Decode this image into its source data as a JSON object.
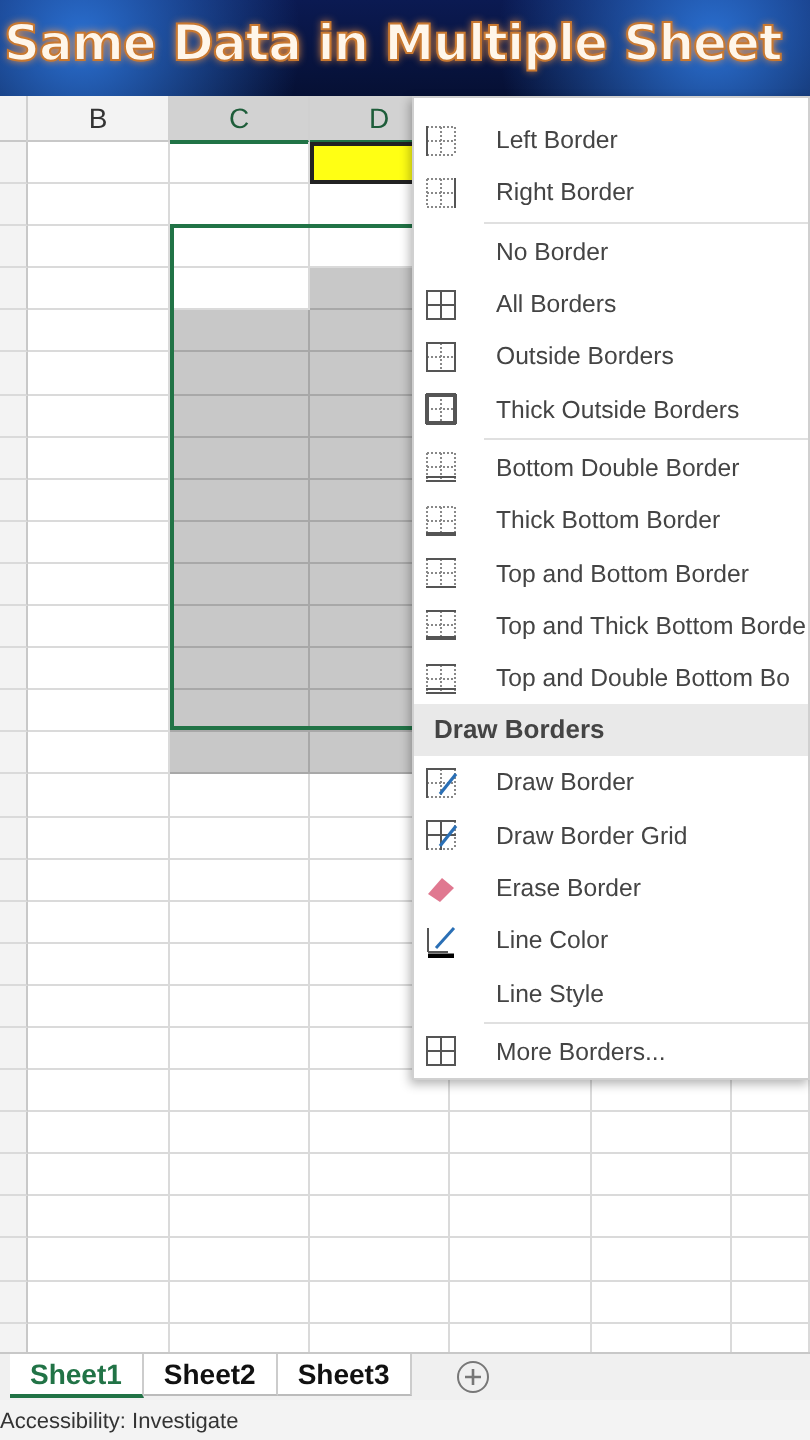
{
  "banner": {
    "title": "Same Data in Multiple Sheet"
  },
  "columns": [
    {
      "label": "B",
      "selected": false
    },
    {
      "label": "C",
      "selected": true
    },
    {
      "label": "D",
      "selected": true
    }
  ],
  "menu": {
    "items": [
      {
        "kind": "item",
        "label": "Left Border"
      },
      {
        "kind": "item",
        "label": "Right Border"
      },
      {
        "kind": "separator"
      },
      {
        "kind": "item",
        "label": "No Border"
      },
      {
        "kind": "item",
        "label": "All Borders"
      },
      {
        "kind": "item",
        "label": "Outside Borders"
      },
      {
        "kind": "item",
        "label": "Thick Outside Borders"
      },
      {
        "kind": "separator"
      },
      {
        "kind": "item",
        "label": "Bottom Double Border"
      },
      {
        "kind": "item",
        "label": "Thick Bottom Border"
      },
      {
        "kind": "item",
        "label": "Top and Bottom Border"
      },
      {
        "kind": "item",
        "label": "Top and Thick Bottom Borde"
      },
      {
        "kind": "item",
        "label": "Top and Double Bottom Bo"
      },
      {
        "kind": "header",
        "label": "Draw Borders"
      },
      {
        "kind": "item",
        "label": "Draw Border"
      },
      {
        "kind": "item",
        "label": "Draw Border Grid"
      },
      {
        "kind": "item",
        "label": "Erase Border"
      },
      {
        "kind": "item",
        "label": "Line Color"
      },
      {
        "kind": "item",
        "label": "Line Style"
      },
      {
        "kind": "separator"
      },
      {
        "kind": "item",
        "label": "More Borders..."
      }
    ]
  },
  "sheet_tabs": [
    {
      "label": "Sheet1",
      "selected": true
    },
    {
      "label": "Sheet2",
      "selected": false
    },
    {
      "label": "Sheet3",
      "selected": false
    }
  ],
  "status_bar": {
    "text": "Accessibility: Investigate"
  }
}
